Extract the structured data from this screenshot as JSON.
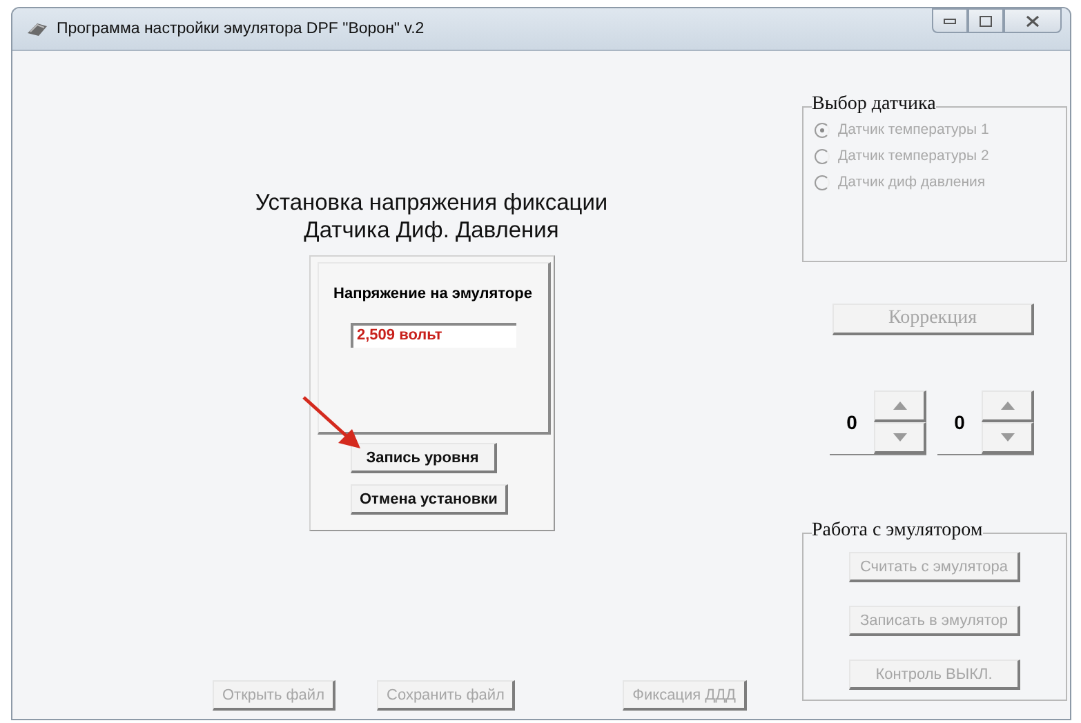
{
  "window": {
    "title": "Программа настройки эмулятора DPF \"Ворон\" v.2"
  },
  "heading": [
    "Установка напряжения фиксации",
    "Датчика Диф. Давления"
  ],
  "voltage_panel": {
    "label": "Напряжение на эмуляторе",
    "value": "2,509 вольт"
  },
  "panel_buttons": [
    {
      "label": "Запись уровня",
      "disabled": false
    },
    {
      "label": "Отмена установки",
      "disabled": false
    }
  ],
  "sensor_group": {
    "title": "Выбор датчика",
    "options": [
      {
        "label": "Датчик температуры 1",
        "selected": true,
        "disabled": true
      },
      {
        "label": "Датчик температуры 2",
        "selected": false,
        "disabled": true
      },
      {
        "label": "Датчик диф давления",
        "selected": false,
        "disabled": true
      }
    ]
  },
  "correction_button": {
    "label": "Коррекция",
    "disabled": true
  },
  "spinners": [
    {
      "value": "0"
    },
    {
      "value": "0"
    }
  ],
  "emulator_group": {
    "title": "Работа с эмулятором",
    "buttons": [
      {
        "label": "Считать с эмулятора",
        "disabled": true
      },
      {
        "label": "Записать в эмулятор",
        "disabled": true
      },
      {
        "label": "Контроль ВЫКЛ.",
        "disabled": true
      }
    ]
  },
  "bottom_buttons": [
    {
      "label": "Открыть файл",
      "disabled": true
    },
    {
      "label": "Сохранить файл",
      "disabled": true
    },
    {
      "label": "Фиксация ДДД",
      "disabled": true
    }
  ],
  "annotations": [
    {
      "kind": "arrow"
    }
  ]
}
